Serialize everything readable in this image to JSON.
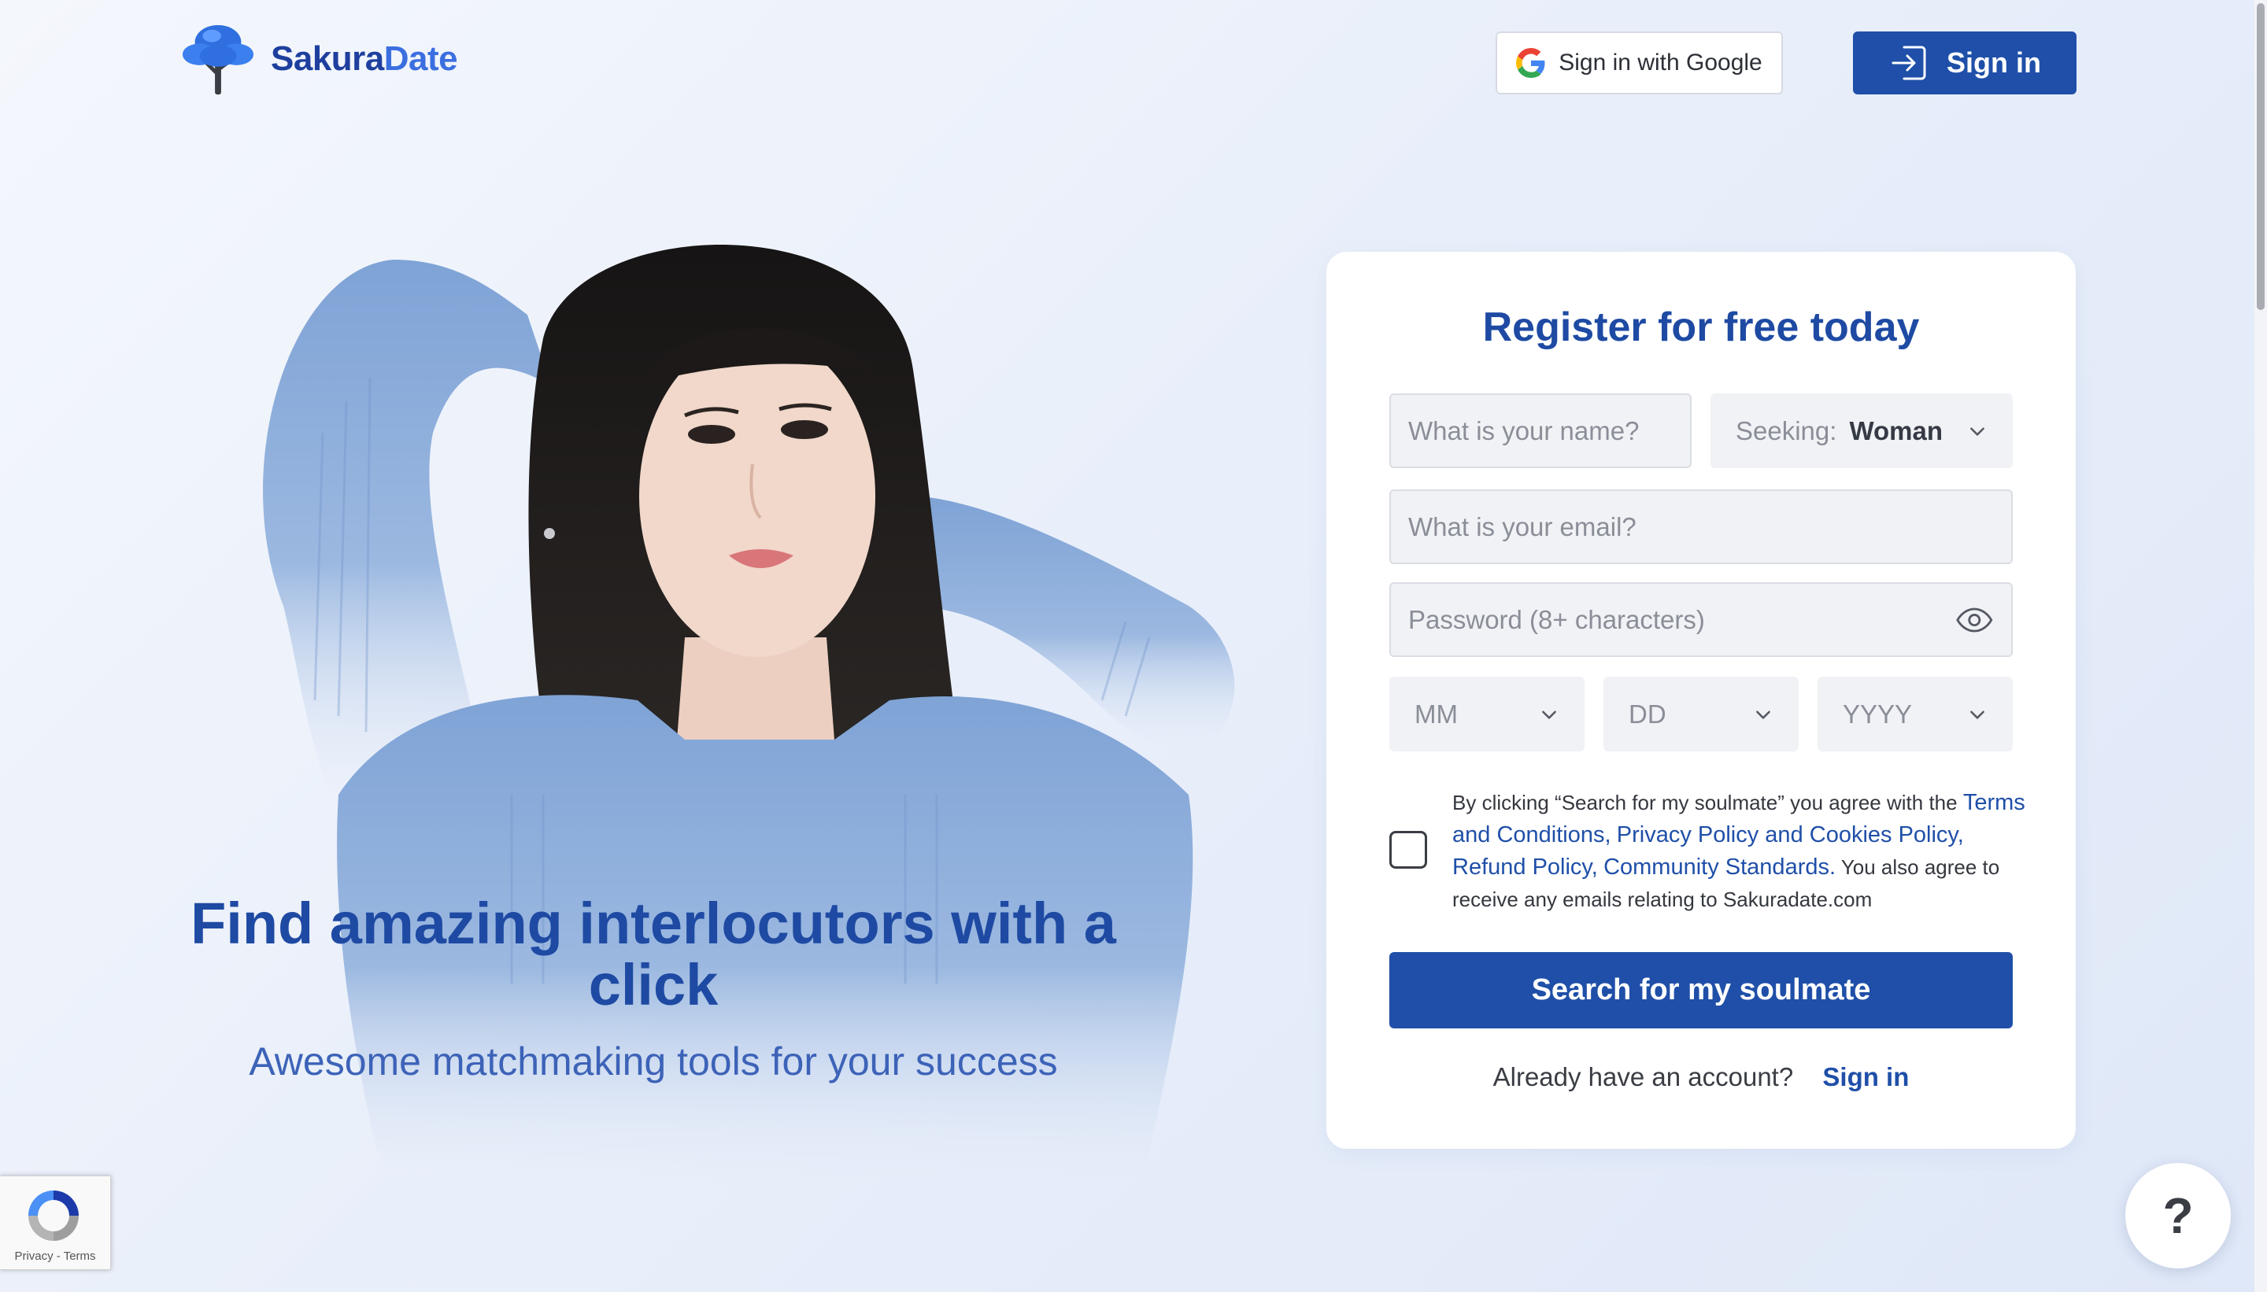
{
  "header": {
    "brand_part1": "Sakura",
    "brand_part2": "Date",
    "google_button": "Sign in with Google",
    "signin_button": "Sign in"
  },
  "hero": {
    "title": "Find amazing interlocutors with a click",
    "subtitle": "Awesome matchmaking tools for your success"
  },
  "form": {
    "title": "Register for free today",
    "name_placeholder": "What is your name?",
    "seeking_label": "Seeking:",
    "seeking_value": "Woman",
    "email_placeholder": "What is your email?",
    "password_placeholder": "Password (8+ characters)",
    "month_placeholder": "MM",
    "day_placeholder": "DD",
    "year_placeholder": "YYYY",
    "consent": {
      "prefix": "By clicking “Search for my soulmate” you agree with the",
      "terms_link": "Terms and Conditions,",
      "privacy_link": "Privacy Policy and Cookies Policy,",
      "refund_link": "Refund Policy,",
      "community_link": "Community Standards.",
      "suffix": "You also agree to receive any emails relating to Sakuradate.com"
    },
    "submit_button": "Search for my soulmate",
    "already_text": "Already have an account?",
    "signin_link": "Sign in"
  },
  "recaptcha": {
    "privacy": "Privacy",
    "separator": "-",
    "terms": "Terms"
  },
  "help_button": "?",
  "icons": {
    "logo": "tree-icon",
    "google": "google-g-icon",
    "signin": "sign-in-arrow-icon",
    "chevron": "chevron-down-icon",
    "password_toggle": "eye-icon",
    "recaptcha": "recaptcha-icon"
  },
  "colors": {
    "brand_primary": "#1f4fa8",
    "brand_light": "#3b6fe0",
    "heading_blue": "#1e4aa3",
    "field_background": "#f1f2f5"
  }
}
